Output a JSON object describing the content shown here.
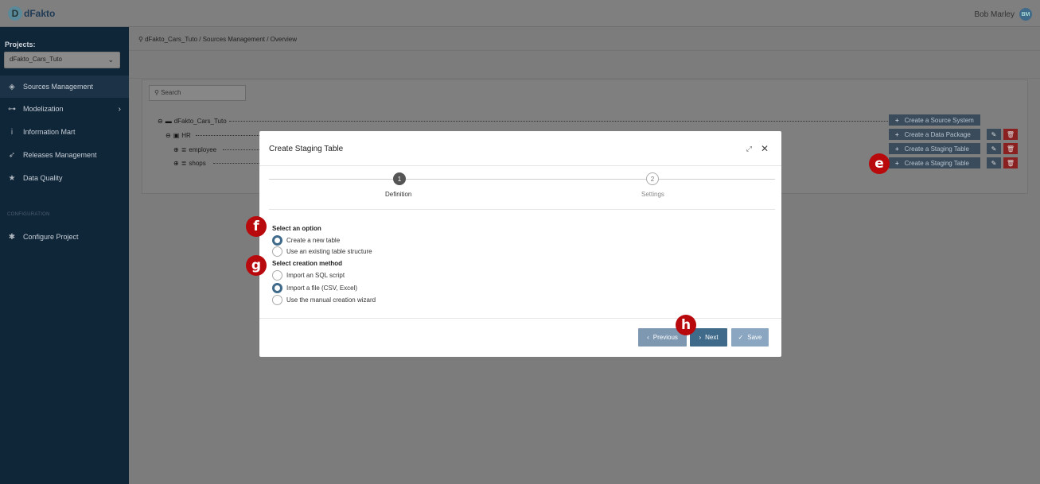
{
  "app": {
    "logo_text": "dFakto",
    "logo_mark": "D",
    "user_name": "Bob Marley",
    "user_initials": "BM"
  },
  "sidebar": {
    "projects_label": "Projects:",
    "project_value": "dFakto_Cars_Tuto",
    "items": [
      {
        "label": "Sources Management",
        "icon": "layers-icon"
      },
      {
        "label": "Modelization",
        "icon": "sitemap-icon"
      },
      {
        "label": "Information Mart",
        "icon": "info-icon"
      },
      {
        "label": "Releases Management",
        "icon": "rocket-icon"
      },
      {
        "label": "Data Quality",
        "icon": "star-icon"
      }
    ],
    "config_section": "CONFIGURATION",
    "config_item": "Configure Project"
  },
  "breadcrumb": "dFakto_Cars_Tuto  /  Sources Management  /  Overview",
  "search_placeholder": "Search",
  "tree": {
    "root": "dFakto_Cars_Tuto",
    "package": "HR",
    "tables": [
      "employee",
      "shops"
    ]
  },
  "actions": {
    "create_source_system": "Create a Source System",
    "create_data_package": "Create a Data Package",
    "create_staging_table_1": "Create a Staging Table",
    "create_staging_table_2": "Create a Staging Table"
  },
  "markers": {
    "e": "e",
    "f": "f",
    "g": "g",
    "h": "h"
  },
  "modal": {
    "title": "Create Staging Table",
    "steps": [
      {
        "num": "1",
        "label": "Definition"
      },
      {
        "num": "2",
        "label": "Settings"
      }
    ],
    "select_option_title": "Select an option",
    "options": [
      "Create a new table",
      "Use an existing table structure"
    ],
    "selected_option": "Create a new table",
    "creation_method_title": "Select creation method",
    "methods": [
      "Import an SQL script",
      "Import a file (CSV, Excel)",
      "Use the manual creation wizard"
    ],
    "selected_method": "Import a file (CSV, Excel)",
    "buttons": {
      "previous": "Previous",
      "next": "Next",
      "save": "Save"
    }
  },
  "colors": {
    "sidebar_bg": "#0f2538",
    "primary": "#3f6a8a",
    "danger": "#8a2020",
    "marker": "#b8090c"
  }
}
